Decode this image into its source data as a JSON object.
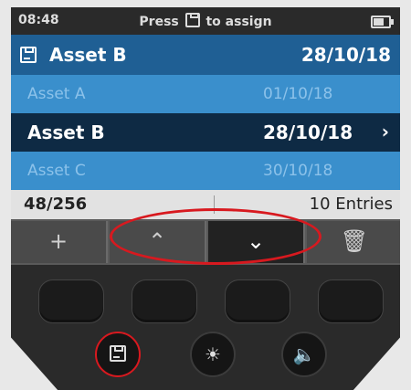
{
  "statusbar": {
    "time": "08:48",
    "message_prefix": "Press",
    "message_suffix": "to assign",
    "battery_icon": "battery-icon"
  },
  "header": {
    "icon": "save-icon",
    "name": "Asset B",
    "date": "28/10/18"
  },
  "list": [
    {
      "name": "Asset A",
      "date": "01/10/18",
      "selected": false
    },
    {
      "name": "Asset B",
      "date": "28/10/18",
      "selected": true,
      "chevron": "›"
    },
    {
      "name": "Asset C",
      "date": "30/10/18",
      "selected": false
    }
  ],
  "footer": {
    "count": "48/256",
    "entries": "10 Entries"
  },
  "softkeys": [
    {
      "icon": "plus-icon",
      "glyph": "+"
    },
    {
      "icon": "chevron-up-icon",
      "glyph": "⌃"
    },
    {
      "icon": "chevron-down-icon",
      "glyph": "⌄",
      "active": true
    },
    {
      "icon": "trash-icon",
      "glyph": "🗑"
    }
  ],
  "hardware_buttons": [
    {
      "icon": "save-icon"
    },
    {
      "icon": "brightness-icon",
      "glyph": "☀"
    },
    {
      "icon": "speaker-icon",
      "glyph": "🔈"
    }
  ],
  "colors": {
    "header_blue": "#1f5f94",
    "row_light_blue": "#3a8fcc",
    "row_selected_navy": "#0e2a44",
    "highlight_red": "#d8191f"
  }
}
